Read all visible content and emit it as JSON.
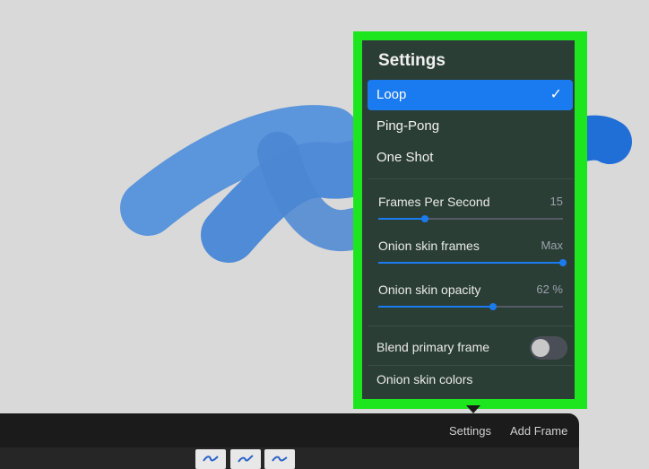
{
  "settings_panel": {
    "title": "Settings",
    "modes": [
      {
        "label": "Loop",
        "selected": true
      },
      {
        "label": "Ping-Pong",
        "selected": false
      },
      {
        "label": "One Shot",
        "selected": false
      }
    ],
    "sliders": [
      {
        "label": "Frames Per Second",
        "value": "15",
        "fraction": 0.25
      },
      {
        "label": "Onion skin frames",
        "value": "Max",
        "fraction": 1.0
      },
      {
        "label": "Onion skin opacity",
        "value": "62 %",
        "fraction": 0.62
      }
    ],
    "blend_primary_frame": {
      "label": "Blend primary frame",
      "on": false
    },
    "onion_skin_colors": {
      "label": "Onion skin colors"
    }
  },
  "timeline": {
    "settings_label": "Settings",
    "add_frame_label": "Add Frame",
    "frame_count": 3
  },
  "colors": {
    "accent": "#1a7bf0",
    "highlight": "#1ee61e",
    "stroke": "#4a90e2"
  }
}
